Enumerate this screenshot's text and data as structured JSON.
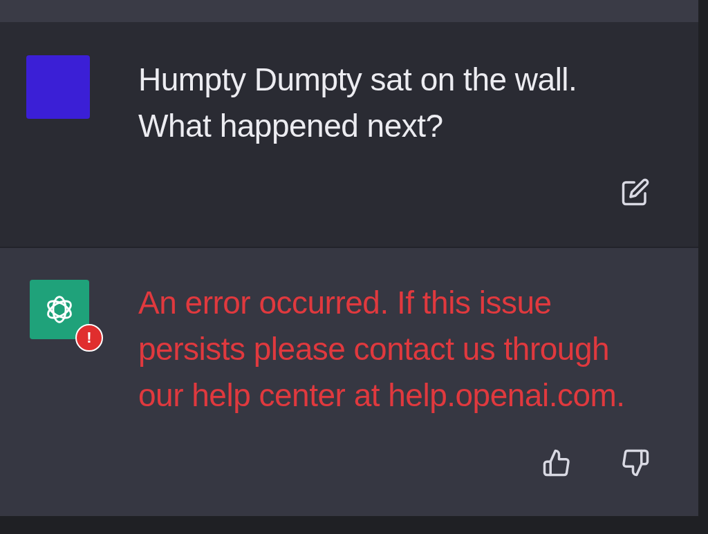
{
  "messages": [
    {
      "kind": "user",
      "text": "Humpty Dumpty sat on the wall. What happened next?",
      "error": false,
      "actions": [
        {
          "kind": "edit"
        }
      ]
    },
    {
      "kind": "assistant",
      "text": "An error occurred. If this issue persists please contact us through our help center at help.openai.com.",
      "error": true,
      "error_badge": "!",
      "actions": [
        {
          "kind": "thumbs-up"
        },
        {
          "kind": "thumbs-down"
        }
      ]
    }
  ]
}
